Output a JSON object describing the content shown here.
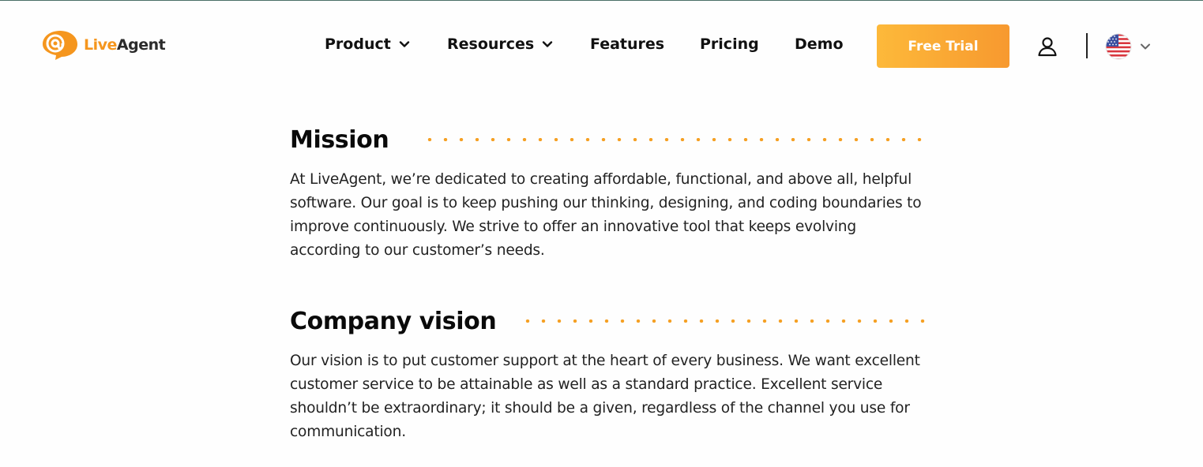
{
  "brand": {
    "name_part1": "Live",
    "name_part2": "Agent",
    "primary_color": "#f5961e",
    "cta_gradient_start": "#fdb93a",
    "cta_gradient_end": "#f7992f"
  },
  "nav": {
    "items": [
      {
        "label": "Product",
        "has_dropdown": true
      },
      {
        "label": "Resources",
        "has_dropdown": true
      },
      {
        "label": "Features",
        "has_dropdown": false
      },
      {
        "label": "Pricing",
        "has_dropdown": false
      },
      {
        "label": "Demo",
        "has_dropdown": false
      }
    ],
    "cta_label": "Free Trial",
    "account_icon": "user-icon",
    "language_icon": "us-flag-icon"
  },
  "sections": [
    {
      "title": "Mission",
      "body": "At LiveAgent, we’re dedicated to creating affordable, functional, and above all, helpful software. Our goal is to keep pushing our thinking, designing, and coding boundaries to improve continuously. We strive to offer an innovative tool that keeps evolving according to our customer’s needs.",
      "lines": [
        "At LiveAgent, we’re dedicated to creating affordable, functional, and above all, helpful",
        "software. Our goal is to keep pushing our thinking, designing, and coding boundaries to",
        "improve continuously. We strive to offer an innovative tool that keeps evolving",
        "according to our customer’s needs."
      ]
    },
    {
      "title": "Company vision",
      "body": "Our vision is to put customer support at the heart of every business. We want excellent customer service to be attainable as well as a standard practice. Excellent service shouldn’t be extraordinary; it should be a given, regardless of the channel you use for communication.",
      "lines": [
        "Our vision is to put customer support at the heart of every business. We want excellent",
        "customer service to be attainable as well as a standard practice. Excellent service",
        "shouldn’t be extraordinary; it should be a given, regardless of the channel you use for",
        "communication."
      ]
    }
  ]
}
